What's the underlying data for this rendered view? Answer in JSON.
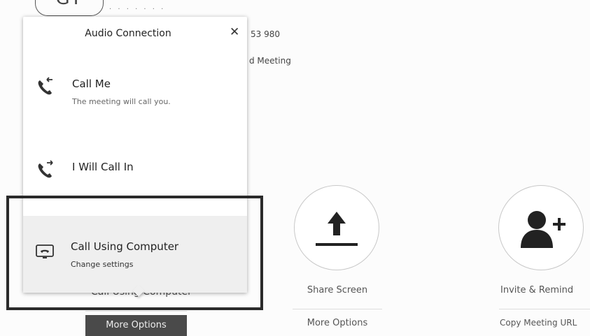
{
  "background": {
    "avatar_initials": "GT",
    "meeting_number": "53 980",
    "meeting_title": "d Meeting"
  },
  "popup": {
    "title": "Audio Connection",
    "close_symbol": "✕",
    "options": [
      {
        "title": "Call Me",
        "description": "The meeting will call you.",
        "icon": "phone-incoming-icon"
      },
      {
        "title": "I Will Call In",
        "description": "",
        "icon": "phone-outgoing-icon"
      },
      {
        "title": "Call Using Computer",
        "description": "Change settings",
        "icon": "computer-audio-icon"
      }
    ]
  },
  "controls": {
    "audio": {
      "label_behind_popup": "Call Using Computer",
      "more_options": "More Options"
    },
    "share": {
      "label": "Share Screen",
      "more_options": "More Options",
      "icon": "upload-arrow-icon"
    },
    "invite": {
      "label": "Invite & Remind",
      "copy_url": "Copy Meeting URL",
      "icon": "add-person-icon"
    }
  },
  "colors": {
    "active_button_bg": "#4a4a4a",
    "selected_option_bg": "#efefef",
    "highlight_border": "#2b2b2b"
  }
}
